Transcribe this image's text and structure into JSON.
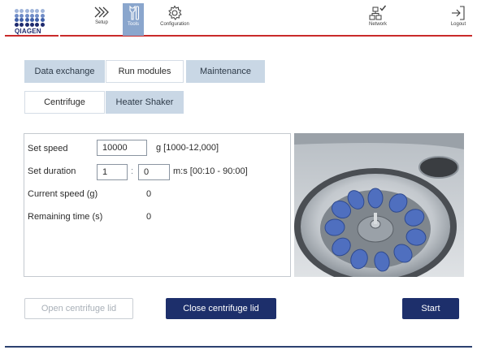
{
  "brand": {
    "name": "QIAGEN",
    "color": "#1e2a6e",
    "accent_red": "#c92a2a"
  },
  "nav": {
    "setup": {
      "label": "Setup",
      "icon": "chevrons-right-icon"
    },
    "tools": {
      "label": "Tools",
      "icon": "tools-icon",
      "active": true
    },
    "configuration": {
      "label": "Configuration",
      "icon": "gear-icon"
    },
    "network": {
      "label": "Network",
      "icon": "network-icon"
    },
    "logout": {
      "label": "Logout",
      "icon": "logout-icon"
    }
  },
  "tabs": [
    {
      "label": "Data exchange",
      "active": false
    },
    {
      "label": "Run modules",
      "active": true
    },
    {
      "label": "Maintenance",
      "active": false
    }
  ],
  "subtabs": [
    {
      "label": "Centrifuge",
      "active": true
    },
    {
      "label": "Heater Shaker",
      "active": false
    }
  ],
  "params": {
    "speed_label": "Set speed",
    "speed_value": "10000",
    "speed_unit": "g [1000-12,000]",
    "duration_label": "Set duration",
    "duration_min": "1",
    "duration_colon": ":",
    "duration_sec": "0",
    "duration_unit": "m:s  [00:10 - 90:00]",
    "current_speed_label": "Current speed (g)",
    "current_speed_value": "0",
    "remaining_label": "Remaining time (s)",
    "remaining_value": "0"
  },
  "buttons": {
    "open_lid": "Open centrifuge lid",
    "close_lid": "Close centrifuge lid",
    "start": "Start"
  },
  "colors": {
    "primary_button": "#1d2f6b",
    "tab_inactive": "#c9d7e5",
    "nav_active": "#8aa6cd",
    "disabled_text": "#a9b0b8"
  }
}
